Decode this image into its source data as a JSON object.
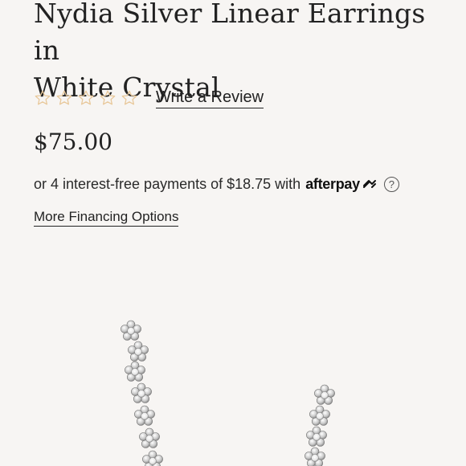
{
  "product": {
    "title_line1": "Nydia Silver Linear Earrings in",
    "title_line2": "White Crystal",
    "rating": 0,
    "rating_max": 5,
    "review_link": "Write a Review",
    "price": "$75.00"
  },
  "payment": {
    "installments_text": "or 4 interest-free payments of $18.75 with",
    "provider": "afterpay",
    "more_options": "More Financing Options"
  },
  "colors": {
    "star_outline": "#e8c89a",
    "text": "#222222",
    "background": "#f7f5f3"
  },
  "image": {
    "subject": "silver-crystal-flower-linear-earrings"
  }
}
